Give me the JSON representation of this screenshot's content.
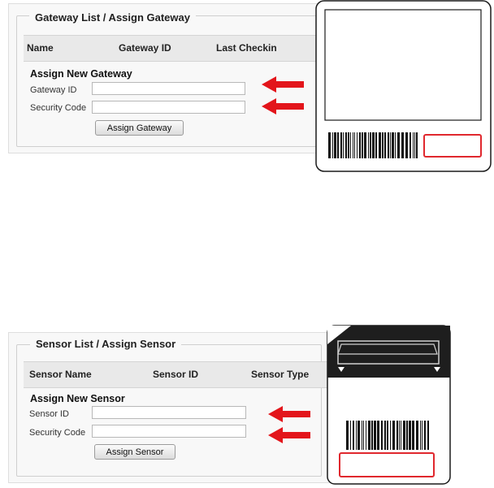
{
  "gateway": {
    "legend": "Gateway List / Assign Gateway",
    "columns": [
      "Name",
      "Gateway ID",
      "Last Checkin"
    ],
    "assign_title": "Assign New Gateway",
    "id_label": "Gateway ID",
    "code_label": "Security Code",
    "id_value": "",
    "code_value": "",
    "button_label": "Assign Gateway"
  },
  "sensor": {
    "legend": "Sensor List / Assign Sensor",
    "columns": [
      "Sensor Name",
      "Sensor ID",
      "Sensor Type"
    ],
    "assign_title": "Assign New Sensor",
    "id_label": "Sensor ID",
    "code_label": "Security Code",
    "id_value": "",
    "code_value": "",
    "button_label": "Assign Sensor"
  },
  "colors": {
    "arrow": "#e3151b",
    "label_box": "#e0282e",
    "device_outline": "#1a1a1a"
  },
  "icons": {
    "pointer": "arrow-left-icon",
    "barcode": "barcode-icon"
  }
}
